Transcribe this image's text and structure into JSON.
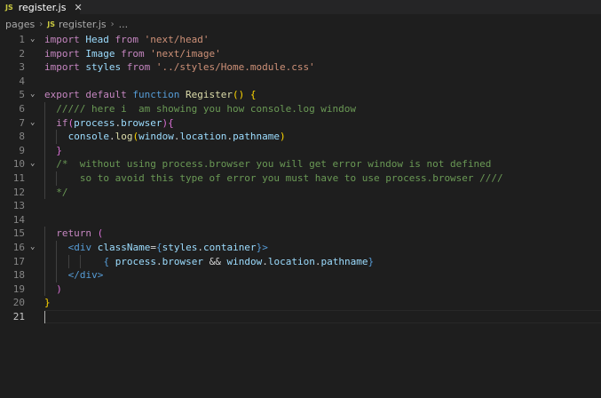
{
  "tab": {
    "badge": "JS",
    "label": "register.js",
    "close": "✕"
  },
  "breadcrumb": {
    "folder": "pages",
    "sep": "›",
    "badge": "JS",
    "file": "register.js",
    "more": "..."
  },
  "code": {
    "lines": [
      {
        "num": "1",
        "fold": true,
        "indent": 0,
        "tokens": [
          [
            "kw",
            "import"
          ],
          [
            "pl",
            " "
          ],
          [
            "var",
            "Head"
          ],
          [
            "pl",
            " "
          ],
          [
            "kw",
            "from"
          ],
          [
            "pl",
            " "
          ],
          [
            "str",
            "'next/head'"
          ]
        ]
      },
      {
        "num": "2",
        "fold": false,
        "indent": 0,
        "tokens": [
          [
            "kw",
            "import"
          ],
          [
            "pl",
            " "
          ],
          [
            "var",
            "Image"
          ],
          [
            "pl",
            " "
          ],
          [
            "kw",
            "from"
          ],
          [
            "pl",
            " "
          ],
          [
            "str",
            "'next/image'"
          ]
        ]
      },
      {
        "num": "3",
        "fold": false,
        "indent": 0,
        "tokens": [
          [
            "kw",
            "import"
          ],
          [
            "pl",
            " "
          ],
          [
            "var",
            "styles"
          ],
          [
            "pl",
            " "
          ],
          [
            "kw",
            "from"
          ],
          [
            "pl",
            " "
          ],
          [
            "str",
            "'../styles/Home.module.css'"
          ]
        ]
      },
      {
        "num": "4",
        "fold": false,
        "indent": 0,
        "tokens": []
      },
      {
        "num": "5",
        "fold": true,
        "indent": 0,
        "tokens": [
          [
            "kw",
            "export"
          ],
          [
            "pl",
            " "
          ],
          [
            "kw",
            "default"
          ],
          [
            "pl",
            " "
          ],
          [
            "kb",
            "function"
          ],
          [
            "pl",
            " "
          ],
          [
            "fn",
            "Register"
          ],
          [
            "br",
            "()"
          ],
          [
            "pl",
            " "
          ],
          [
            "br",
            "{"
          ]
        ]
      },
      {
        "num": "6",
        "fold": false,
        "indent": 1,
        "tokens": [
          [
            "cm",
            "///// here i  am showing you how console.log window"
          ]
        ]
      },
      {
        "num": "7",
        "fold": true,
        "indent": 1,
        "tokens": [
          [
            "kw",
            "if"
          ],
          [
            "pu",
            "("
          ],
          [
            "var",
            "process"
          ],
          [
            "pl",
            "."
          ],
          [
            "var",
            "browser"
          ],
          [
            "pu",
            ")"
          ],
          [
            "pu",
            "{"
          ]
        ]
      },
      {
        "num": "8",
        "fold": false,
        "indent": 2,
        "tokens": [
          [
            "var",
            "console"
          ],
          [
            "pl",
            "."
          ],
          [
            "fn",
            "log"
          ],
          [
            "br",
            "("
          ],
          [
            "var",
            "window"
          ],
          [
            "pl",
            "."
          ],
          [
            "var",
            "location"
          ],
          [
            "pl",
            "."
          ],
          [
            "var",
            "pathname"
          ],
          [
            "br",
            ")"
          ]
        ]
      },
      {
        "num": "9",
        "fold": false,
        "indent": 1,
        "tokens": [
          [
            "pu",
            "}"
          ]
        ]
      },
      {
        "num": "10",
        "fold": true,
        "indent": 1,
        "tokens": [
          [
            "cm",
            "/*  without using process.browser you will get error window is not defined"
          ]
        ]
      },
      {
        "num": "11",
        "fold": false,
        "indent": 2,
        "tokens": [
          [
            "cm",
            "  so to avoid this type of error you must have to use process.browser ////"
          ]
        ]
      },
      {
        "num": "12",
        "fold": false,
        "indent": 1,
        "tokens": [
          [
            "cm",
            "*/"
          ]
        ]
      },
      {
        "num": "13",
        "fold": false,
        "indent": 0,
        "tokens": []
      },
      {
        "num": "14",
        "fold": false,
        "indent": 0,
        "tokens": []
      },
      {
        "num": "15",
        "fold": false,
        "indent": 1,
        "tokens": [
          [
            "kw",
            "return"
          ],
          [
            "pl",
            " "
          ],
          [
            "pu",
            "("
          ]
        ]
      },
      {
        "num": "16",
        "fold": true,
        "indent": 2,
        "tokens": [
          [
            "tag",
            "<div"
          ],
          [
            "pl",
            " "
          ],
          [
            "attr",
            "className"
          ],
          [
            "pl",
            "="
          ],
          [
            "kb",
            "{"
          ],
          [
            "var",
            "styles"
          ],
          [
            "pl",
            "."
          ],
          [
            "var",
            "container"
          ],
          [
            "kb",
            "}"
          ],
          [
            "tag",
            ">"
          ]
        ]
      },
      {
        "num": "17",
        "fold": false,
        "indent": 4,
        "tokens": [
          [
            "pl",
            "  "
          ],
          [
            "kb",
            "{"
          ],
          [
            "pl",
            " "
          ],
          [
            "var",
            "process"
          ],
          [
            "pl",
            "."
          ],
          [
            "var",
            "browser"
          ],
          [
            "pl",
            " && "
          ],
          [
            "var",
            "window"
          ],
          [
            "pl",
            "."
          ],
          [
            "var",
            "location"
          ],
          [
            "pl",
            "."
          ],
          [
            "var",
            "pathname"
          ],
          [
            "kb",
            "}"
          ]
        ]
      },
      {
        "num": "18",
        "fold": false,
        "indent": 2,
        "tokens": [
          [
            "tag",
            "</div>"
          ]
        ]
      },
      {
        "num": "19",
        "fold": false,
        "indent": 1,
        "tokens": [
          [
            "pu",
            ")"
          ]
        ]
      },
      {
        "num": "20",
        "fold": false,
        "indent": 0,
        "tokens": [
          [
            "br",
            "}"
          ]
        ]
      },
      {
        "num": "21",
        "fold": false,
        "indent": 0,
        "tokens": [],
        "current": true
      }
    ]
  }
}
